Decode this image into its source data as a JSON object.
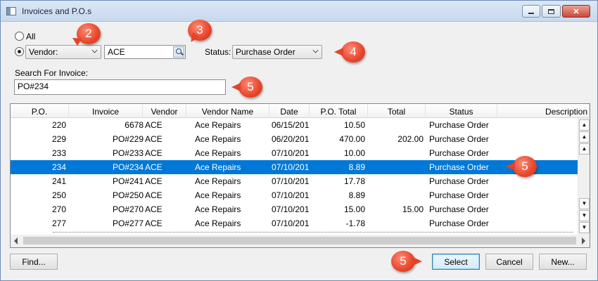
{
  "window": {
    "title": "Invoices and P.O.s",
    "controls": {
      "minimize_icon": "minimize-icon",
      "maximize_icon": "maximize-icon",
      "close_glyph": "✕"
    }
  },
  "filters": {
    "all_label": "All",
    "all_selected": false,
    "vendor_selected": true,
    "vendor_combo_value": "Vendor:",
    "vendor_value": "ACE",
    "status_label": "Status:",
    "status_value": "Purchase Order",
    "search_label": "Search For Invoice:",
    "search_value": "PO#234"
  },
  "grid": {
    "columns": [
      "P.O.",
      "Invoice",
      "Vendor",
      "Vendor Name",
      "Date",
      "P.O. Total",
      "Total",
      "Status",
      "Description"
    ],
    "rows": [
      {
        "po": "220",
        "invoice": "6678",
        "vendor": "ACE",
        "vendor_name": "Ace Repairs",
        "date": "06/15/201",
        "po_total": "10.50",
        "total": "",
        "status": "Purchase Order"
      },
      {
        "po": "229",
        "invoice": "PO#229",
        "vendor": "ACE",
        "vendor_name": "Ace Repairs",
        "date": "06/20/201",
        "po_total": "470.00",
        "total": "202.00",
        "status": "Purchase Order"
      },
      {
        "po": "233",
        "invoice": "PO#233",
        "vendor": "ACE",
        "vendor_name": "Ace Repairs",
        "date": "07/10/201",
        "po_total": "10.00",
        "total": "",
        "status": "Purchase Order"
      },
      {
        "po": "234",
        "invoice": "PO#234",
        "vendor": "ACE",
        "vendor_name": "Ace Repairs",
        "date": "07/10/201",
        "po_total": "8.89",
        "total": "",
        "status": "Purchase Order"
      },
      {
        "po": "241",
        "invoice": "PO#241",
        "vendor": "ACE",
        "vendor_name": "Ace Repairs",
        "date": "07/10/201",
        "po_total": "17.78",
        "total": "",
        "status": "Purchase Order"
      },
      {
        "po": "250",
        "invoice": "PO#250",
        "vendor": "ACE",
        "vendor_name": "Ace Repairs",
        "date": "07/10/201",
        "po_total": "8.89",
        "total": "",
        "status": "Purchase Order"
      },
      {
        "po": "270",
        "invoice": "PO#270",
        "vendor": "ACE",
        "vendor_name": "Ace Repairs",
        "date": "07/10/201",
        "po_total": "15.00",
        "total": "15.00",
        "status": "Purchase Order"
      },
      {
        "po": "277",
        "invoice": "PO#277",
        "vendor": "ACE",
        "vendor_name": "Ace Repairs",
        "date": "07/10/201",
        "po_total": "-1.78",
        "total": "",
        "status": "Purchase Order"
      }
    ],
    "selected_row_index": 3,
    "selection_color": "#0078d7"
  },
  "buttons": {
    "find": "Find...",
    "select": "Select",
    "cancel": "Cancel",
    "new": "New..."
  },
  "callouts": {
    "vendor": "2",
    "vendor_value": "3",
    "status": "4",
    "search": "5",
    "selected_row": "5",
    "select_button": "5",
    "color": "#e8452c"
  }
}
